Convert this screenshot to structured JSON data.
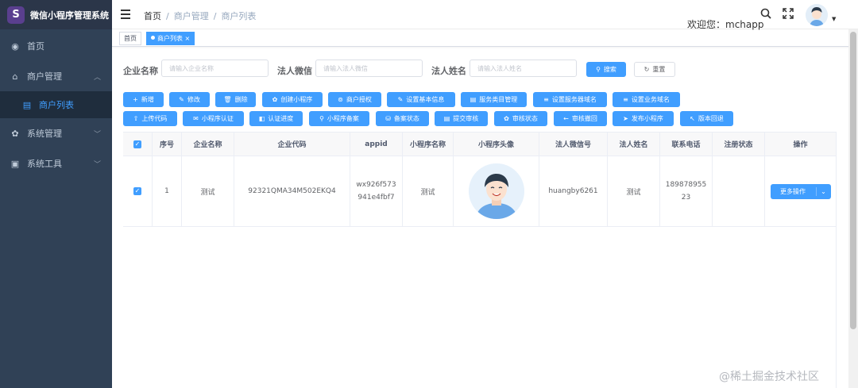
{
  "app": {
    "title": "微信小程序管理系统",
    "logo_letter": "S"
  },
  "sidebar": {
    "items": [
      {
        "label": "首页",
        "icon": "dashboard-icon"
      },
      {
        "label": "商户管理",
        "icon": "shop-icon"
      },
      {
        "label": "商户列表",
        "icon": "list-icon"
      },
      {
        "label": "系统管理",
        "icon": "gear-icon"
      },
      {
        "label": "系统工具",
        "icon": "toolbox-icon"
      }
    ]
  },
  "header": {
    "breadcrumb": [
      "首页",
      "商户管理",
      "商户列表"
    ],
    "welcome": "欢迎您：mchapp"
  },
  "tags": [
    {
      "label": "首页"
    },
    {
      "label": "商户列表",
      "close": "×"
    }
  ],
  "search": {
    "company_label": "企业名称",
    "company_placeholder": "请输入企业名称",
    "wechat_label": "法人微信",
    "wechat_placeholder": "请输入法人微信",
    "name_label": "法人姓名",
    "name_placeholder": "请输入法人姓名",
    "search_btn": "搜索",
    "reset_btn": "重置"
  },
  "toolbar": {
    "row1": [
      "新增",
      "修改",
      "删除",
      "创建小程序",
      "商户授权",
      "设置基本信息",
      "服务类目管理",
      "设置服务器域名",
      "设置业务域名"
    ],
    "row2": [
      "上传代码",
      "小程序认证",
      "认证进度",
      "小程序备案",
      "备案状态",
      "提交审核",
      "审核状态",
      "审核撤回",
      "发布小程序",
      "版本回退"
    ]
  },
  "table": {
    "headers": [
      "序号",
      "企业名称",
      "企业代码",
      "appid",
      "小程序名称",
      "小程序头像",
      "法人微信号",
      "法人姓名",
      "联系电话",
      "注册状态",
      "操作"
    ],
    "rows": [
      {
        "index": "1",
        "company": "测试",
        "code": "92321QMA34M502EKQ4",
        "appid_line1": "wx926f573",
        "appid_line2": "941e4fbf7",
        "app_name": "测试",
        "wechat": "huangby6261",
        "legal_name": "测试",
        "phone_line1": "189878955",
        "phone_line2": "23",
        "status": "",
        "action": "更多操作"
      }
    ]
  },
  "watermark": "@稀土掘金技术社区",
  "colors": {
    "sidebar": "#304156",
    "primary": "#409eff"
  }
}
